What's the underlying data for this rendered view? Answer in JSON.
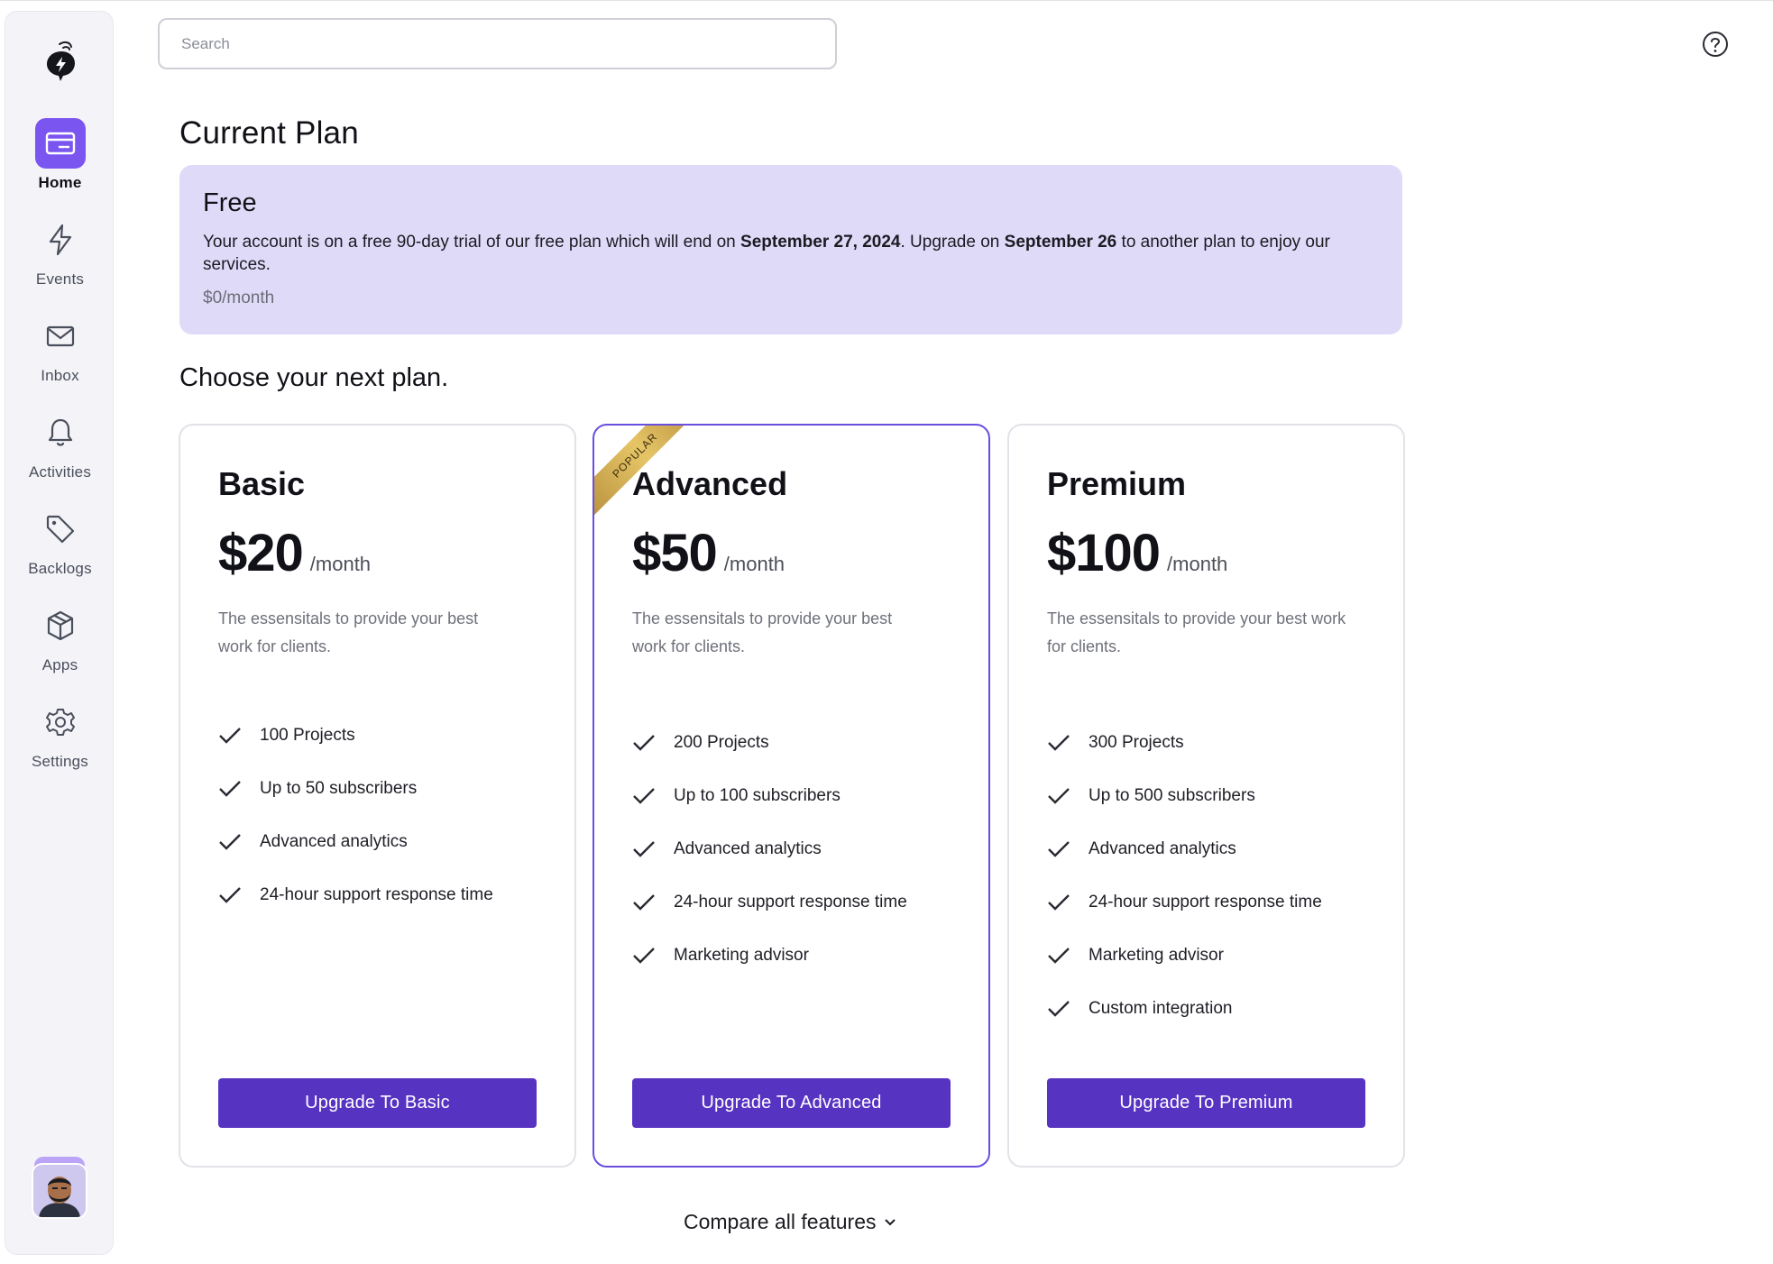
{
  "sidebar": {
    "items": [
      {
        "label": "Home",
        "icon": "card-icon",
        "active": true
      },
      {
        "label": "Events",
        "icon": "lightning-icon"
      },
      {
        "label": "Inbox",
        "icon": "mail-icon"
      },
      {
        "label": "Activities",
        "icon": "bell-icon"
      },
      {
        "label": "Backlogs",
        "icon": "tag-icon"
      },
      {
        "label": "Apps",
        "icon": "box-icon"
      },
      {
        "label": "Settings",
        "icon": "gear-icon"
      }
    ]
  },
  "search": {
    "placeholder": "Search"
  },
  "page_title": "Current Plan",
  "current_plan": {
    "name": "Free",
    "desc_1": "Your account is on a free 90-day trial of our free plan which will end on ",
    "end_date": "September 27, 2024",
    "desc_2": ". Upgrade on ",
    "upgrade_date": "September 26",
    "desc_3": " to another plan to enjoy our services.",
    "price": "$0/month"
  },
  "choose_title": "Choose your next plan.",
  "plans": [
    {
      "name": "Basic",
      "price": "$20",
      "per": "/month",
      "desc": "The essensitals to provide your best work for clients.",
      "features": [
        "100 Projects",
        "Up to 50 subscribers",
        "Advanced analytics",
        "24-hour support response time"
      ],
      "button": "Upgrade To Basic"
    },
    {
      "name": "Advanced",
      "price": "$50",
      "per": "/month",
      "ribbon": "POPULAR",
      "desc": "The essensitals to provide your best work for clients.",
      "features": [
        "200 Projects",
        "Up to 100 subscribers",
        "Advanced analytics",
        "24-hour support response time",
        "Marketing advisor"
      ],
      "button": "Upgrade To Advanced"
    },
    {
      "name": "Premium",
      "price": "$100",
      "per": "/month",
      "desc": "The essensitals to provide your best work for clients.",
      "features": [
        "300 Projects",
        "Up to 500 subscribers",
        "Advanced analytics",
        "24-hour support response time",
        "Marketing advisor",
        "Custom integration"
      ],
      "button": "Upgrade To Premium"
    }
  ],
  "compare_label": "Compare all features",
  "colors": {
    "accent": "#5733c2",
    "nav_active": "#7b55f0",
    "current_bg": "#e0daf9",
    "popular_border": "#6a4ee0"
  }
}
